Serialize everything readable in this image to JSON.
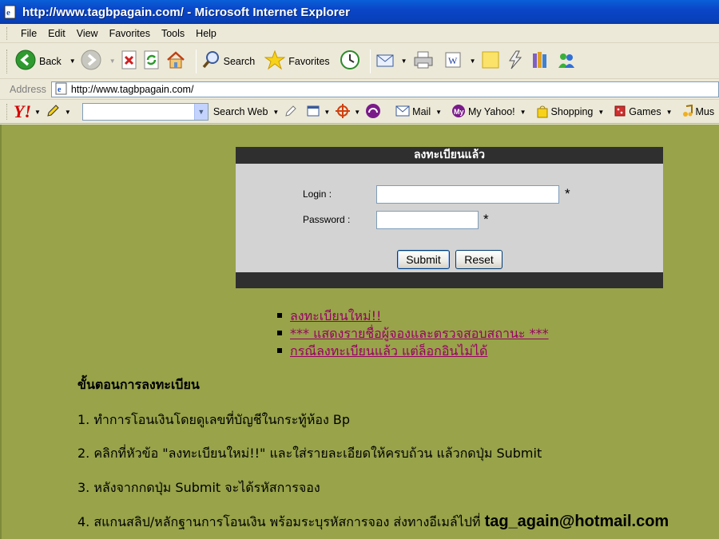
{
  "window": {
    "title": "http://www.tagbpagain.com/ - Microsoft Internet Explorer"
  },
  "menu": {
    "items": [
      "File",
      "Edit",
      "View",
      "Favorites",
      "Tools",
      "Help"
    ]
  },
  "toolbar": {
    "back_label": "Back",
    "search_label": "Search",
    "favorites_label": "Favorites"
  },
  "address": {
    "label": "Address",
    "url": "http://www.tagbpagain.com/"
  },
  "yahoo": {
    "search_button": "Search Web",
    "mail_label": "Mail",
    "my_yahoo_label": "My Yahoo!",
    "shopping_label": "Shopping",
    "games_label": "Games",
    "music_label": "Mus"
  },
  "login": {
    "heading": "ลงทะเบียนแล้ว",
    "login_label": "Login :",
    "password_label": "Password :",
    "required_mark": "*",
    "submit_label": "Submit",
    "reset_label": "Reset"
  },
  "links": [
    "ลงทะเบียนใหม่!!",
    "*** แสดงรายชื่อผู้จองและตรวจสอบสถานะ ***",
    "กรณีลงทะเบียนแล้ว แต่ล็อกอินไม่ได้"
  ],
  "steps": {
    "title": "ขั้นตอนการลงทะเบียน",
    "step1": "1. ทำการโอนเงินโดยดูเลขที่บัญชีในกระทู้ห้อง Bp",
    "step2": "2. คลิกที่หัวข้อ \"ลงทะเบียนใหม่!!\" และใส่รายละเอียดให้ครบถ้วน แล้วกดปุ่ม Submit",
    "step3": "3. หลังจากกดปุ่ม Submit จะได้รหัสการจอง",
    "step4": "4. สแกนสลิป/หลักฐานการโอนเงิน พร้อมระบุรหัสการจอง ส่งทางอีเมล์ไปที่ ",
    "email": "tag_again@hotmail.com"
  },
  "colors": {
    "page_bg": "#98a34a",
    "panel_bg": "#d3d3d3",
    "panel_bar": "#2f2f2f",
    "link": "#990066"
  }
}
